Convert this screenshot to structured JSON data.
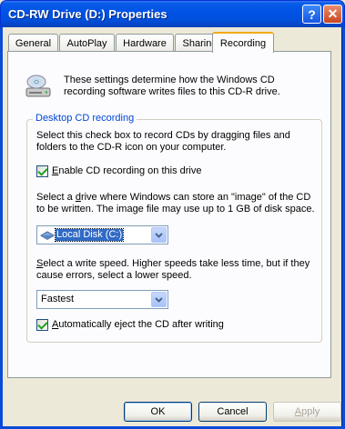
{
  "window": {
    "title": "CD-RW Drive (D:) Properties",
    "help_glyph": "?",
    "close_glyph": "✕"
  },
  "tabs": [
    {
      "label": "General"
    },
    {
      "label": "AutoPlay"
    },
    {
      "label": "Hardware"
    },
    {
      "label": "Sharing"
    },
    {
      "label": "Recording",
      "active": true
    }
  ],
  "intro": {
    "text": "These settings determine how the Windows CD recording software writes files to this CD-R drive."
  },
  "desktop_group": {
    "title": "Desktop CD recording",
    "description": "Select this check box to record CDs by dragging files and folders to the CD-R icon on your computer.",
    "enable_checkbox": {
      "label_mnemonic": "E",
      "label_rest": "nable CD recording on this drive",
      "checked": true
    },
    "drive_text_1": "Select a ",
    "drive_text_mnemonic": "d",
    "drive_text_2": "rive where Windows can store an \"image\" of the CD to be written. The image file may use up to 1 GB of disk space.",
    "drive_select": {
      "value": "Local Disk (C:)"
    },
    "speed_text_mnemonic": "S",
    "speed_text_rest": "elect a write speed.  Higher speeds take less time, but if they cause errors, select a lower speed.",
    "speed_select": {
      "value": "Fastest"
    },
    "eject_checkbox": {
      "label_mnemonic": "A",
      "label_rest": "utomatically eject the CD after writing",
      "checked": true
    }
  },
  "buttons": {
    "ok": "OK",
    "cancel": "Cancel",
    "apply_mnemonic": "A",
    "apply_rest": "pply"
  },
  "colors": {
    "title_bar": "#0053E6",
    "group_title": "#0046D5",
    "active_tab_accent": "#F4A91A",
    "check_mark": "#21A121",
    "selection": "#316AC5"
  }
}
